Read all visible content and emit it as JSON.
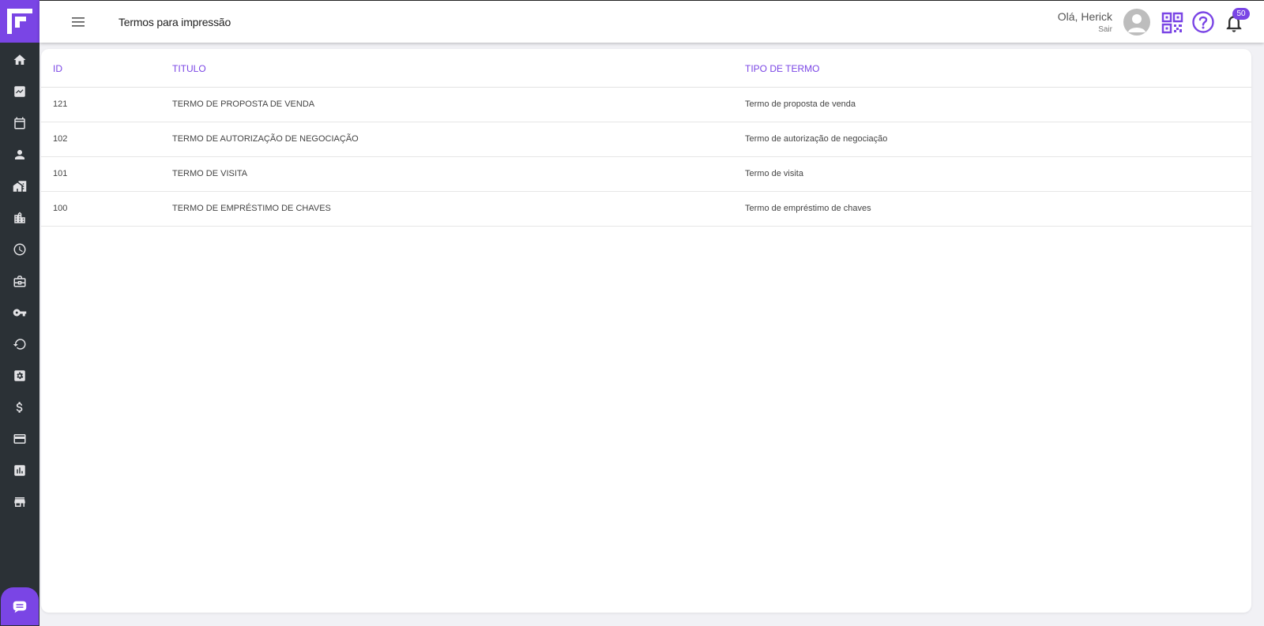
{
  "header": {
    "title": "Termos para impressão",
    "greeting": "Olá, Herick",
    "logout": "Sair",
    "notifications_count": "50"
  },
  "sidebar": {
    "items": [
      {
        "icon": "home-icon"
      },
      {
        "icon": "trending-icon"
      },
      {
        "icon": "calendar-icon"
      },
      {
        "icon": "person-icon"
      },
      {
        "icon": "house-icon"
      },
      {
        "icon": "buildings-icon"
      },
      {
        "icon": "clock-icon"
      },
      {
        "icon": "briefcase-icon"
      },
      {
        "icon": "key-icon"
      },
      {
        "icon": "restore-icon"
      },
      {
        "icon": "settings-box-icon"
      },
      {
        "icon": "dollar-icon"
      },
      {
        "icon": "credit-card-icon"
      },
      {
        "icon": "chart-icon"
      },
      {
        "icon": "store-icon"
      }
    ]
  },
  "table": {
    "columns": [
      "ID",
      "TITULO",
      "TIPO DE TERMO"
    ],
    "rows": [
      {
        "id": "121",
        "title": "TERMO DE PROPOSTA DE VENDA",
        "type": "Termo de proposta de venda"
      },
      {
        "id": "102",
        "title": "TERMO DE AUTORIZAÇÃO DE NEGOCIAÇÃO",
        "type": "Termo de autorização de negociação"
      },
      {
        "id": "101",
        "title": "TERMO DE VISITA",
        "type": "Termo de visita"
      },
      {
        "id": "100",
        "title": "TERMO DE EMPRÉSTIMO DE CHAVES",
        "type": "Termo de empréstimo de chaves"
      }
    ]
  },
  "colors": {
    "accent": "#7a45e5",
    "sidebar": "#2b3136"
  }
}
